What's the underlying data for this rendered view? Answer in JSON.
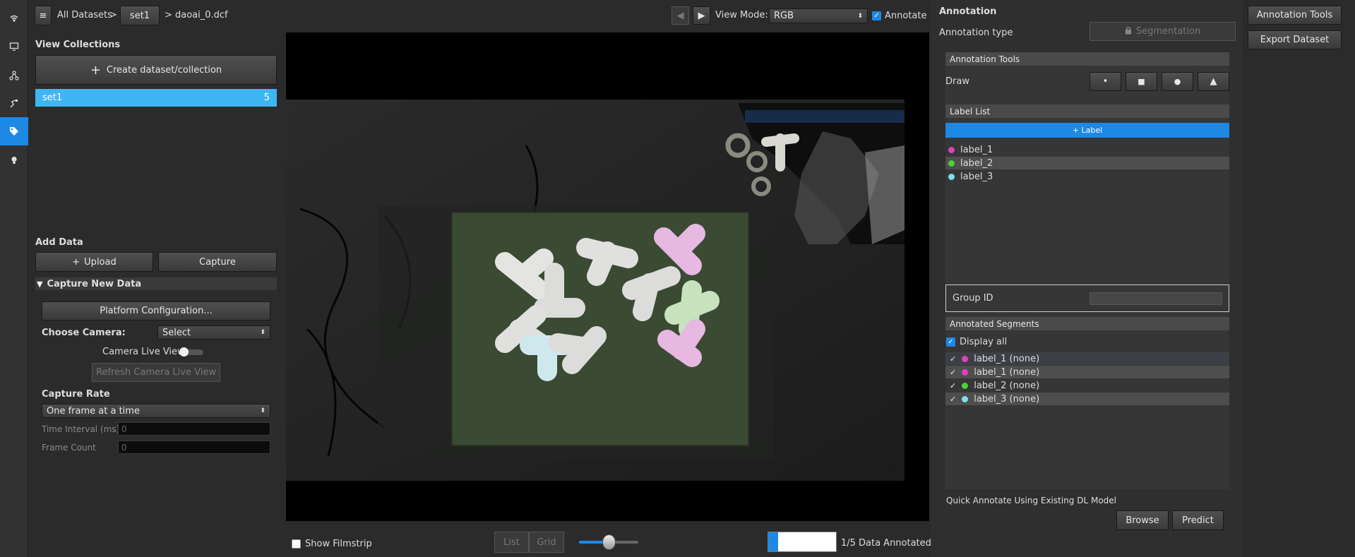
{
  "header": {
    "breadcrumb_root": "All Datasets",
    "sep1": ">",
    "breadcrumb_set": "set1",
    "sep2": ">",
    "breadcrumb_file": "daoai_0.dcf",
    "view_mode_label": "View Mode:",
    "view_mode_value": "RGB",
    "annotate_label": "Annotate"
  },
  "left_panel": {
    "view_collections_title": "View Collections",
    "create_button": "Create dataset/collection",
    "collections": [
      {
        "name": "set1",
        "count": "5"
      }
    ],
    "add_data_title": "Add Data",
    "upload_button": "Upload",
    "capture_button": "Capture",
    "capture_new_data_title": "Capture New Data",
    "platform_config_button": "Platform Configuration...",
    "choose_camera_label": "Choose Camera:",
    "choose_camera_value": "Select",
    "camera_live_view_label": "Camera Live View",
    "refresh_button": "Refresh Camera Live View",
    "capture_rate_title": "Capture Rate",
    "capture_rate_value": "One frame at a time",
    "time_interval_label": "Time Interval (ms)",
    "time_interval_value": "0",
    "frame_count_label": "Frame Count",
    "frame_count_value": "0"
  },
  "bottom_bar": {
    "show_filmstrip_label": "Show Filmstrip",
    "list_button": "List",
    "grid_button": "Grid",
    "slider_value": 0.5,
    "annotated_progress": 0.2,
    "annotated_count": "1/5",
    "annotated_label": "Data Annotated"
  },
  "annotation_panel": {
    "title": "Annotation",
    "type_label": "Annotation type",
    "segmentation_button": "Segmentation",
    "tools_section": "Annotation Tools",
    "draw_label": "Draw",
    "draw_tools": [
      {
        "name": "point-tool",
        "glyph": "•"
      },
      {
        "name": "square-tool",
        "glyph": "■"
      },
      {
        "name": "circle-tool",
        "glyph": "●"
      },
      {
        "name": "polygon-tool",
        "glyph": "▲"
      }
    ],
    "label_list_section": "Label List",
    "add_label_button": "+ Label",
    "labels": [
      {
        "name": "label_1",
        "color": "#e040c0"
      },
      {
        "name": "label_2",
        "color": "#4cd137"
      },
      {
        "name": "label_3",
        "color": "#7fe0f0"
      }
    ],
    "group_id_label": "Group ID",
    "annotated_segments_section": "Annotated Segments",
    "display_all_label": "Display all",
    "segments": [
      {
        "text": "label_1 (none)",
        "color": "#e040c0"
      },
      {
        "text": "label_1 (none)",
        "color": "#e040c0"
      },
      {
        "text": "label_2 (none)",
        "color": "#4cd137"
      },
      {
        "text": "label_3 (none)",
        "color": "#7fe0f0"
      }
    ],
    "quick_annotate_label": "Quick Annotate Using Existing DL Model",
    "browse_button": "Browse",
    "predict_button": "Predict"
  },
  "right_buttons": {
    "annotation_tools": "Annotation Tools",
    "export_dataset": "Export Dataset"
  },
  "colors": {
    "accent": "#1e88e5",
    "selection": "#3fb6f2",
    "background": "#2b2b2b"
  }
}
